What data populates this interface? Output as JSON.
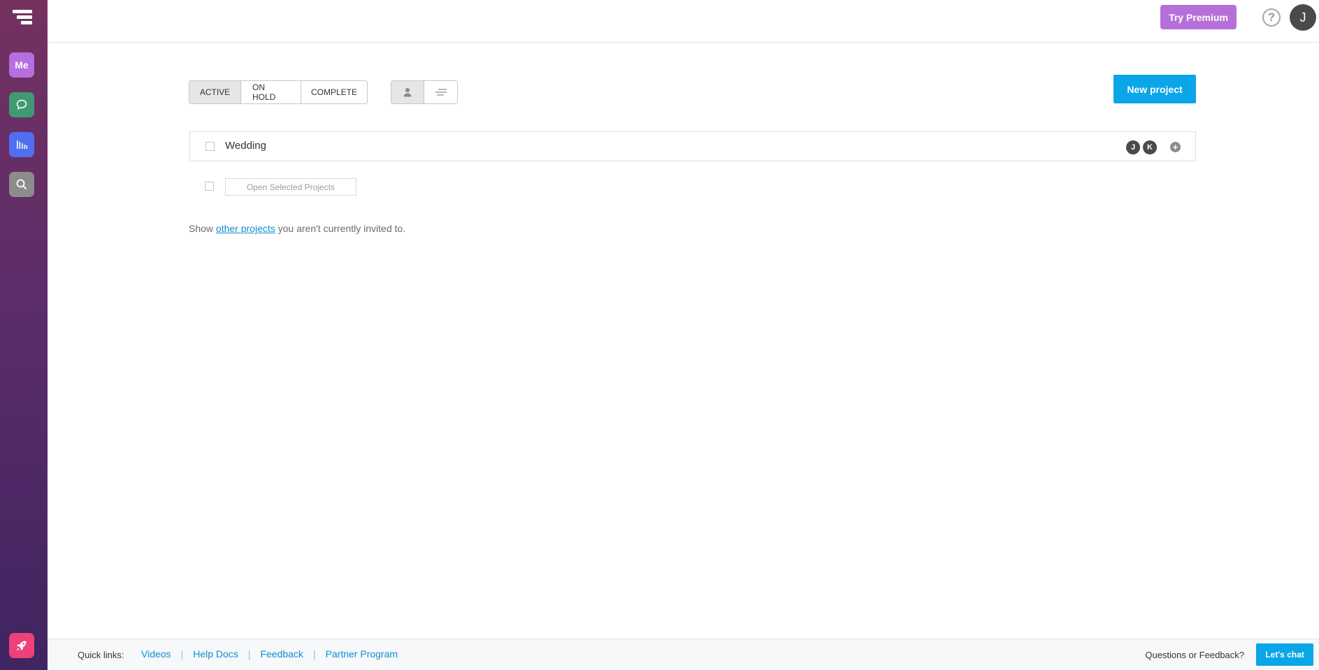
{
  "sidebar": {
    "logo_icon": "app-logo-icon",
    "items": [
      {
        "label": "Me",
        "icon": "me-icon",
        "color": "#b66fe0"
      },
      {
        "label": "",
        "icon": "chat-icon",
        "color": "#3f9a72"
      },
      {
        "label": "",
        "icon": "stats-icon",
        "color": "#4f6ff0"
      },
      {
        "label": "",
        "icon": "search-icon",
        "color": "#8c8c8c"
      },
      {
        "label": "",
        "icon": "rocket-icon",
        "color": "#f0407a"
      }
    ]
  },
  "header": {
    "try_premium": "Try Premium",
    "help_icon": "?",
    "user_initial": "J"
  },
  "filters": {
    "status_tabs": [
      {
        "label": "ACTIVE",
        "selected": true
      },
      {
        "label": "ON HOLD",
        "selected": false
      },
      {
        "label": "COMPLETE",
        "selected": false
      }
    ],
    "view_options": [
      {
        "icon": "person-icon",
        "selected": true
      },
      {
        "icon": "sort-lines-icon",
        "selected": false
      }
    ]
  },
  "actions": {
    "new_project": "New project",
    "open_selected": "Open Selected Projects"
  },
  "projects": [
    {
      "name": "Wedding",
      "members": [
        "J",
        "K"
      ],
      "add_member": "+"
    }
  ],
  "other_projects": {
    "prefix": "Show ",
    "link": "other projects",
    "suffix": " you aren't currently invited to."
  },
  "footer": {
    "quick_links_label": "Quick links:",
    "links": [
      "Videos",
      "Help Docs",
      "Feedback",
      "Partner Program"
    ],
    "separator": "|",
    "questions": "Questions or Feedback?",
    "lets_chat": "Let's chat"
  },
  "colors": {
    "primary_blue": "#0aa6e8",
    "premium_purple": "#b66fd8",
    "sidebar_top": "#74315f",
    "sidebar_bottom": "#3f2560"
  }
}
